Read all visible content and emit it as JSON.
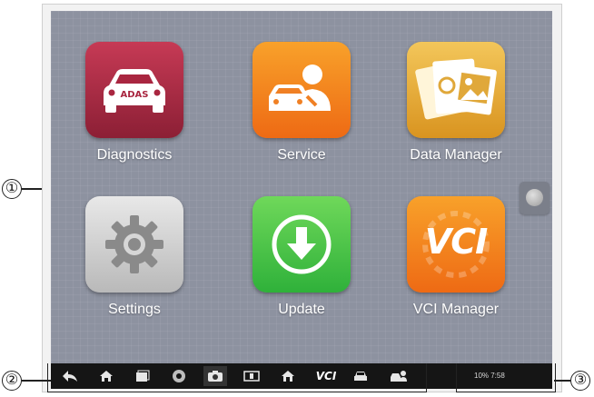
{
  "apps": [
    {
      "label": "Diagnostics",
      "badge": "ADAS",
      "icon": "car-adas-icon"
    },
    {
      "label": "Service",
      "icon": "car-service-icon"
    },
    {
      "label": "Data Manager",
      "icon": "photo-files-icon"
    },
    {
      "label": "Settings",
      "icon": "gear-icon"
    },
    {
      "label": "Update",
      "icon": "download-arrow-icon"
    },
    {
      "label": "VCI Manager",
      "text": "VCI",
      "icon": "vci-icon"
    }
  ],
  "navbar": {
    "vci_label": "VCI",
    "icons": [
      "back-icon",
      "home-icon",
      "recent-apps-icon",
      "chrome-icon",
      "camera-icon",
      "screen-mirror-icon",
      "home-shortcut-icon",
      "vci-icon",
      "car-icon",
      "car-service-icon"
    ]
  },
  "status_bar": {
    "text": "10%  7:58"
  },
  "callouts": [
    "①",
    "②",
    "③"
  ],
  "colors": {
    "screen_bg": "#8d92a0",
    "diagnostics": "#b12d48",
    "service": "#f38420",
    "data_manager": "#e5ad3a",
    "settings": "#cfcfcf",
    "update": "#4cc44a",
    "vci_manager": "#f38420",
    "navbar": "#151515"
  }
}
